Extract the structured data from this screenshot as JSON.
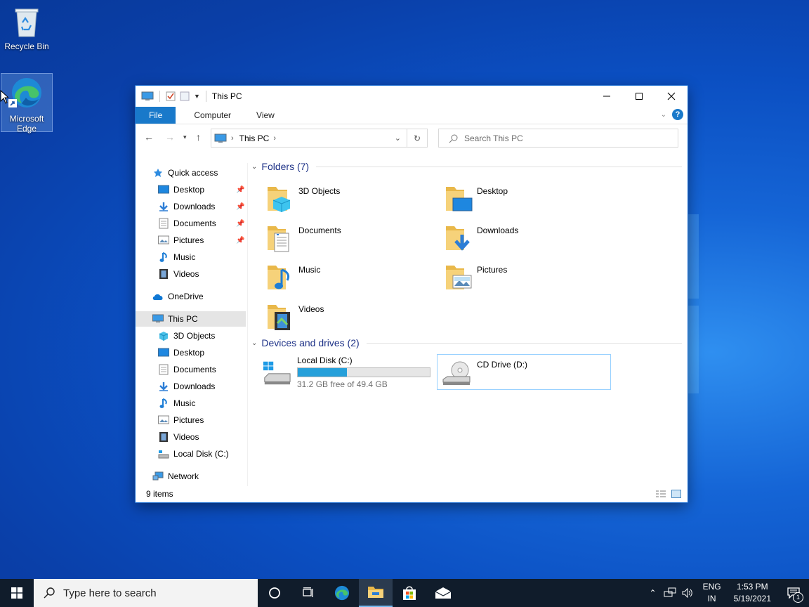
{
  "desktop": {
    "icons": [
      {
        "label": "Recycle Bin"
      },
      {
        "label": "Microsoft Edge"
      }
    ]
  },
  "window": {
    "title": "This PC",
    "ribbon_tabs": [
      "File",
      "Computer",
      "View"
    ],
    "address": {
      "crumb": "This PC"
    },
    "search": {
      "placeholder": "Search This PC"
    },
    "nav": {
      "quick_access": "Quick access",
      "quick_items": [
        "Desktop",
        "Downloads",
        "Documents",
        "Pictures",
        "Music",
        "Videos"
      ],
      "onedrive": "OneDrive",
      "this_pc": "This PC",
      "pc_items": [
        "3D Objects",
        "Desktop",
        "Documents",
        "Downloads",
        "Music",
        "Pictures",
        "Videos",
        "Local Disk (C:)"
      ],
      "network": "Network"
    },
    "folders_header": "Folders (7)",
    "folders": [
      "3D Objects",
      "Desktop",
      "Documents",
      "Downloads",
      "Music",
      "Pictures",
      "Videos"
    ],
    "devices_header": "Devices and drives (2)",
    "drives": [
      {
        "name": "Local Disk (C:)",
        "free": "31.2 GB free of 49.4 GB",
        "used_fraction": 0.37
      },
      {
        "name": "CD Drive (D:)"
      }
    ],
    "status": "9 items"
  },
  "taskbar": {
    "search_placeholder": "Type here to search",
    "lang": [
      "ENG",
      "IN"
    ],
    "time": "1:53 PM",
    "date": "5/19/2021",
    "notification_count": "1"
  },
  "colors": {
    "accent": "#1979ca",
    "taskbar": "#101c2b",
    "drive_bar": "#26a0da"
  }
}
